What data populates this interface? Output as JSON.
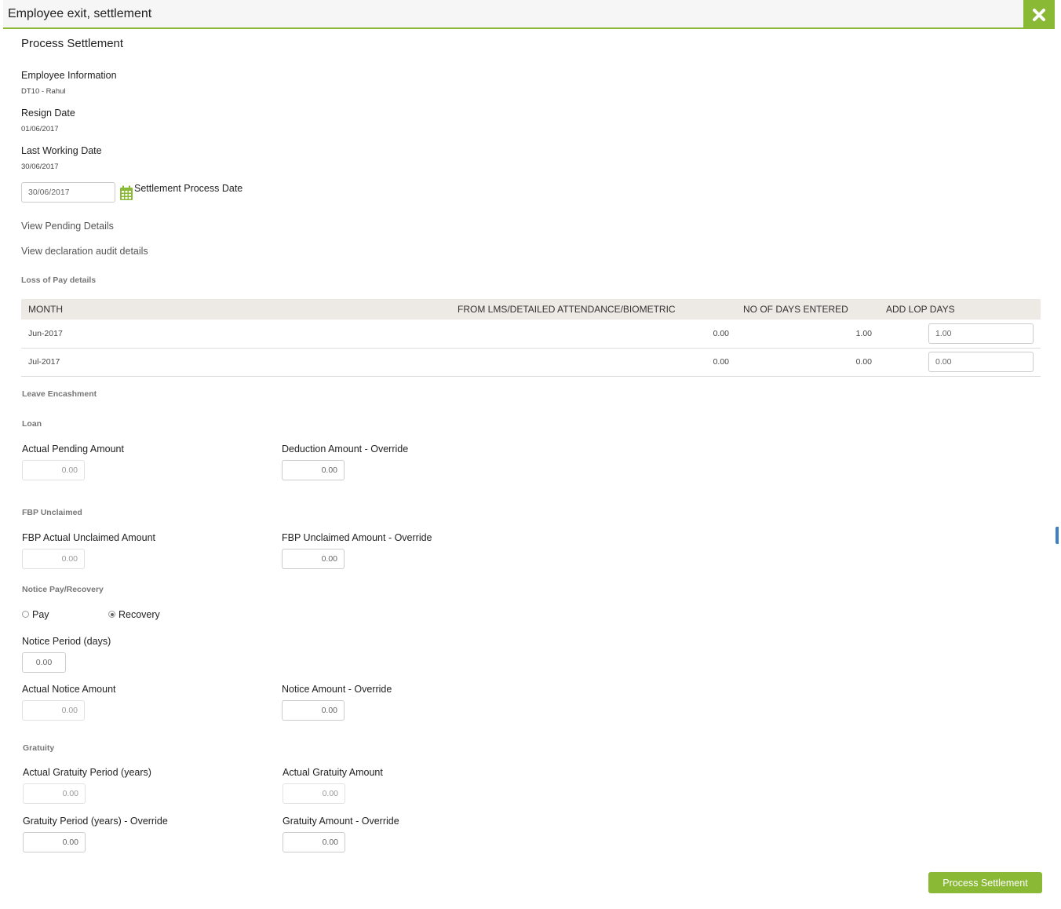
{
  "header": {
    "title": "Employee exit, settlement"
  },
  "page_title": "Process Settlement",
  "employee": {
    "info_label": "Employee Information",
    "info_value": "DT10 - Rahul",
    "resign_label": "Resign Date",
    "resign_value": "01/06/2017",
    "lwd_label": "Last Working Date",
    "lwd_value": "30/06/2017"
  },
  "settlement_date": {
    "value": "30/06/2017",
    "label": "Settlement Process Date"
  },
  "links": {
    "pending": "View Pending Details",
    "audit": "View declaration audit details"
  },
  "lop": {
    "title": "Loss of Pay details",
    "headers": [
      "MONTH",
      "FROM LMS/DETAILED ATTENDANCE/BIOMETRIC",
      "NO OF DAYS ENTERED",
      "ADD LOP DAYS"
    ],
    "rows": [
      {
        "month": "Jun-2017",
        "from_lms": "0.00",
        "days_entered": "1.00",
        "add_lop": "1.00"
      },
      {
        "month": "Jul-2017",
        "from_lms": "0.00",
        "days_entered": "0.00",
        "add_lop": "0.00"
      }
    ]
  },
  "leave_encashment": {
    "title": "Leave Encashment"
  },
  "loan": {
    "title": "Loan",
    "actual_label": "Actual Pending Amount",
    "actual_value": "0.00",
    "override_label": "Deduction Amount - Override",
    "override_value": "0.00"
  },
  "fbp": {
    "title": "FBP Unclaimed",
    "actual_label": "FBP Actual Unclaimed Amount",
    "actual_value": "0.00",
    "override_label": "FBP Unclaimed Amount - Override",
    "override_value": "0.00"
  },
  "notice": {
    "title": "Notice Pay/Recovery",
    "options": [
      "Pay",
      "Recovery"
    ],
    "selected": "Recovery",
    "period_label": "Notice Period (days)",
    "period_value": "0.00",
    "actual_label": "Actual Notice Amount",
    "actual_value": "0.00",
    "override_label": "Notice Amount - Override",
    "override_value": "0.00"
  },
  "gratuity": {
    "title": "Gratuity",
    "period_label": "Actual Gratuity Period (years)",
    "period_value": "0.00",
    "amount_label": "Actual Gratuity Amount",
    "amount_value": "0.00",
    "period_override_label": "Gratuity Period (years) - Override",
    "period_override_value": "0.00",
    "amount_override_label": "Gratuity Amount - Override",
    "amount_override_value": "0.00"
  },
  "actions": {
    "submit": "Process Settlement"
  },
  "colors": {
    "accent": "#8ab936",
    "table_header": "#ede9e4"
  }
}
